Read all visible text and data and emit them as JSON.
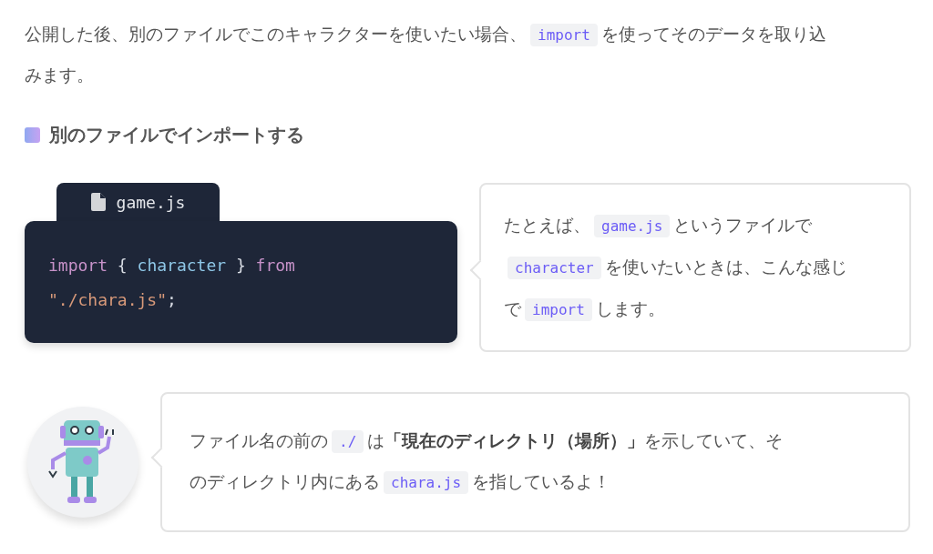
{
  "intro": [
    {
      "kind": "text",
      "text": "公開した後、別のファイルでこのキャラクターを使いたい場合、"
    },
    {
      "kind": "code",
      "text": "import"
    },
    {
      "kind": "text",
      "text": "を使ってそのデータを取り込みます。"
    }
  ],
  "heading": "別のファイルでインポートする",
  "code_block": {
    "filename": "game.js",
    "lines": [
      [
        {
          "kind": "keyword",
          "text": "import"
        },
        {
          "kind": "punct",
          "text": " { "
        },
        {
          "kind": "ident",
          "text": "character"
        },
        {
          "kind": "punct",
          "text": " } "
        },
        {
          "kind": "keyword",
          "text": "from"
        }
      ],
      [
        {
          "kind": "string",
          "text": "\"./chara.js\""
        },
        {
          "kind": "punct",
          "text": ";"
        }
      ]
    ]
  },
  "explanation": [
    {
      "kind": "text",
      "text": "たとえば、"
    },
    {
      "kind": "code",
      "text": "game.js"
    },
    {
      "kind": "text",
      "text": "というファイルで"
    },
    {
      "kind": "code",
      "text": "character"
    },
    {
      "kind": "text",
      "text": "を使いたいときは、こんな感じで"
    },
    {
      "kind": "code",
      "text": "import"
    },
    {
      "kind": "text",
      "text": "します。"
    }
  ],
  "robot_comment": [
    {
      "kind": "text",
      "text": "ファイル名の前の"
    },
    {
      "kind": "code",
      "text": "./"
    },
    {
      "kind": "text",
      "text": "は"
    },
    {
      "kind": "bold",
      "text": "「現在のディレクトリ（場所）」"
    },
    {
      "kind": "text",
      "text": "を示していて、そのディレクトリ内にある"
    },
    {
      "kind": "code",
      "text": "chara.js"
    },
    {
      "kind": "text",
      "text": "を指しているよ！"
    }
  ]
}
